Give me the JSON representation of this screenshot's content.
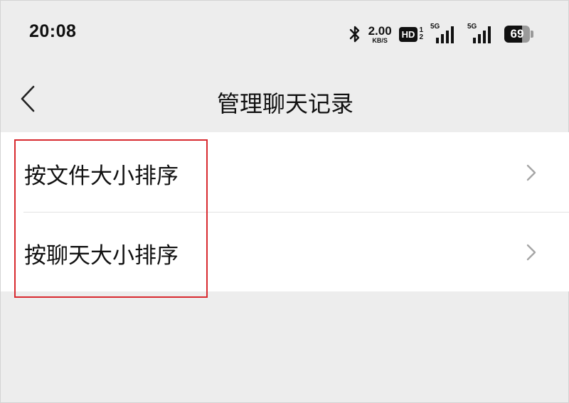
{
  "status_bar": {
    "time": "20:08",
    "net_speed_value": "2.00",
    "net_speed_unit": "KB/S",
    "hd_label": "HD",
    "hd_slot_top": "1",
    "hd_slot_bottom": "2",
    "sim1_gen": "5G",
    "sim2_gen": "5G",
    "battery_level": "69",
    "icons": [
      "bluetooth-icon",
      "hd-voice-icon",
      "signal-icon",
      "signal-icon",
      "battery-icon"
    ]
  },
  "header": {
    "title": "管理聊天记录",
    "back_icon": "chevron-left-icon"
  },
  "list": {
    "items": [
      {
        "label": "按文件大小排序",
        "icon": "chevron-right-icon"
      },
      {
        "label": "按聊天大小排序",
        "icon": "chevron-right-icon"
      }
    ]
  },
  "colors": {
    "background": "#ededed",
    "card": "#ffffff",
    "highlight_border": "#d8292f",
    "text": "#111111",
    "chevron": "#a6a6a6"
  }
}
